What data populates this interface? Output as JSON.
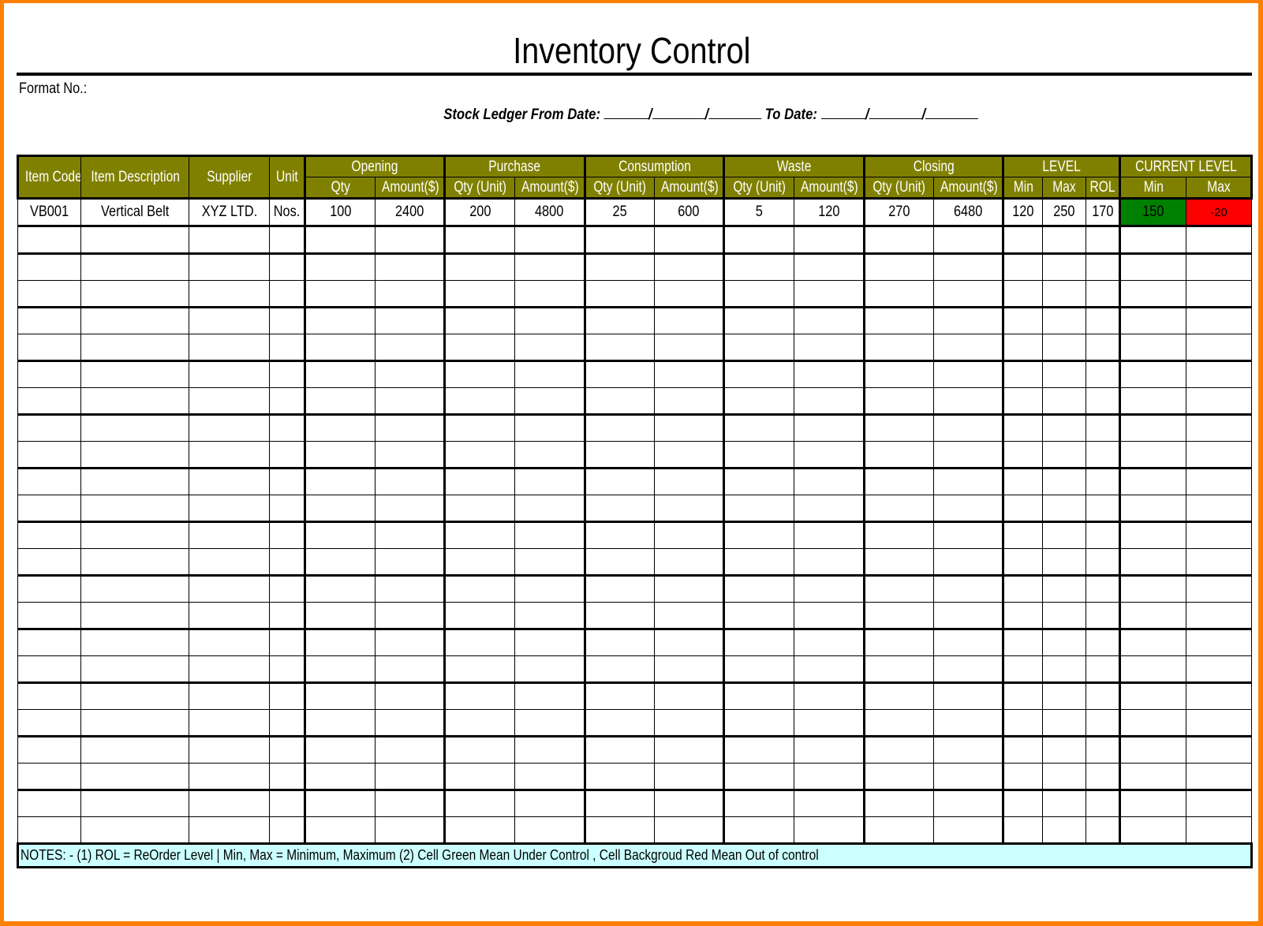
{
  "document": {
    "title": "Inventory Control",
    "format_no_label": "Format No.:",
    "ledger": {
      "from_label": "Stock Ledger From Date:",
      "to_label": "To Date:",
      "separator": "/"
    }
  },
  "colors": {
    "header_bg": "#808000",
    "header_text": "#ffffff",
    "under_control": "#008000",
    "out_of_control": "#ff0000",
    "notes_bg": "#ccffff",
    "frame": "#ff8000"
  },
  "table": {
    "headers": {
      "item_code": "Item Code",
      "item_description": "Item Description",
      "supplier": "Supplier",
      "unit": "Unit",
      "groups": [
        {
          "label": "Opening",
          "sub": [
            "Qty",
            "Amount($)"
          ]
        },
        {
          "label": "Purchase",
          "sub": [
            "Qty (Unit)",
            "Amount($)"
          ]
        },
        {
          "label": "Consumption",
          "sub": [
            "Qty (Unit)",
            "Amount($)"
          ]
        },
        {
          "label": "Waste",
          "sub": [
            "Qty (Unit)",
            "Amount($)"
          ]
        },
        {
          "label": "Closing",
          "sub": [
            "Qty (Unit)",
            "Amount($)"
          ]
        },
        {
          "label": "LEVEL",
          "sub": [
            "Min",
            "Max",
            "ROL"
          ]
        },
        {
          "label": "CURRENT LEVEL",
          "sub": [
            "Min",
            "Max"
          ]
        }
      ]
    },
    "rows": [
      {
        "item_code": "VB001",
        "item_description": "Vertical Belt",
        "supplier": "XYZ LTD.",
        "unit": "Nos.",
        "opening_qty": "100",
        "opening_amount": "2400",
        "purchase_qty": "200",
        "purchase_amount": "4800",
        "consumption_qty": "25",
        "consumption_amount": "600",
        "waste_qty": "5",
        "waste_amount": "120",
        "closing_qty": "270",
        "closing_amount": "6480",
        "level_min": "120",
        "level_max": "250",
        "level_rol": "170",
        "current_min": "150",
        "current_max": "-20",
        "current_min_status": "under-control",
        "current_max_status": "out-of-control"
      }
    ],
    "empty_row_count": 23,
    "notes": "NOTES: - (1) ROL = ReOrder Level | Min, Max = Minimum, Maximum      (2) Cell Green Mean Under Control , Cell Backgroud Red Mean Out of control"
  }
}
